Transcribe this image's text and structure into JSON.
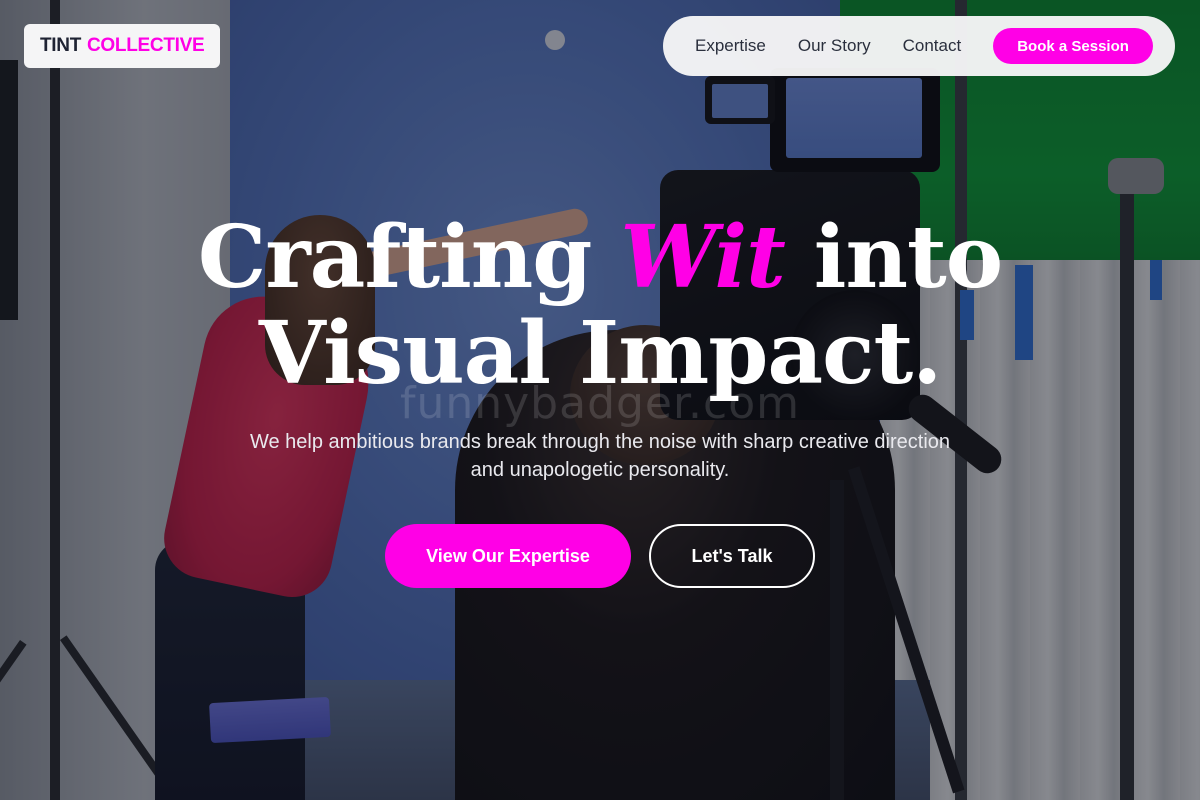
{
  "brand": {
    "name_part1": "TINT",
    "name_part2": "COLLECTIVE",
    "accent_color": "#ff00e6",
    "dark_color": "#1f2333"
  },
  "nav": {
    "links": [
      {
        "label": "Expertise"
      },
      {
        "label": "Our Story"
      },
      {
        "label": "Contact"
      }
    ],
    "cta_label": "Book a Session"
  },
  "hero": {
    "title_part1": "Crafting",
    "title_accent": "Wit",
    "title_part2": "into",
    "title_line2": "Visual Impact.",
    "subtitle": "We help ambitious brands break through the noise with sharp creative direction and unapologetic personality.",
    "primary_cta": "View Our Expertise",
    "secondary_cta": "Let's Talk"
  },
  "watermark": {
    "text": "funnybadger.com"
  }
}
